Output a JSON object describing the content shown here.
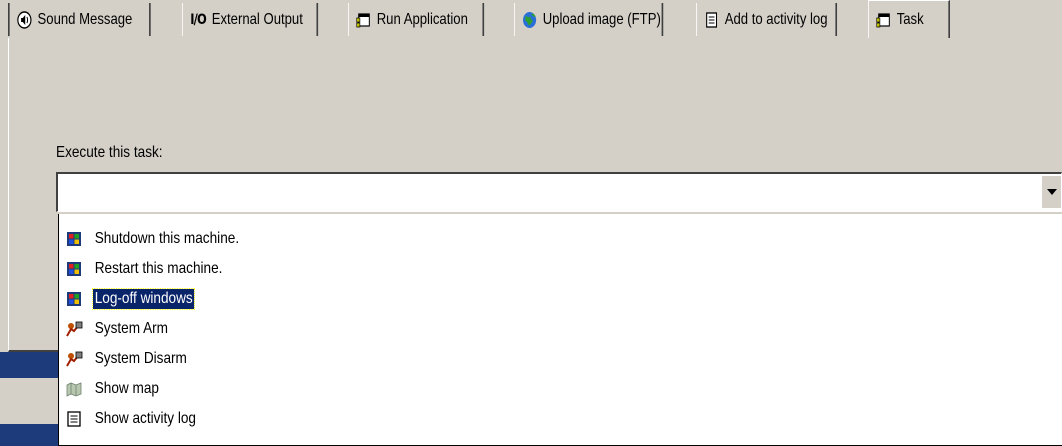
{
  "tabs": [
    {
      "label": "Sound Message",
      "icon": "speaker-icon"
    },
    {
      "label": "External Output",
      "icon": "io-icon",
      "icon_text": "I/O"
    },
    {
      "label": "Run Application",
      "icon": "application-window-icon"
    },
    {
      "label": "Upload image (FTP)",
      "icon": "globe-icon"
    },
    {
      "label": "Add to activity log",
      "icon": "log-document-icon"
    },
    {
      "label": "Task",
      "icon": "task-window-icon",
      "active": true
    }
  ],
  "task_field": {
    "label": "Execute this task:",
    "value": ""
  },
  "dropdown": {
    "items": [
      {
        "label": "Shutdown this machine.",
        "icon": "windows-flag-icon"
      },
      {
        "label": "Restart this machine.",
        "icon": "windows-flag-icon"
      },
      {
        "label": "Log-off windows",
        "icon": "windows-flag-icon",
        "selected": true
      },
      {
        "label": "System Arm",
        "icon": "keypad-user-icon"
      },
      {
        "label": "System Disarm",
        "icon": "keypad-user-icon"
      },
      {
        "label": "Show map",
        "icon": "map-icon"
      },
      {
        "label": "Show activity log",
        "icon": "log-document-icon"
      }
    ]
  },
  "colors": {
    "face": "#d4d0c8",
    "selection": "#0a246a",
    "frame_blue": "#1d3a7a"
  }
}
